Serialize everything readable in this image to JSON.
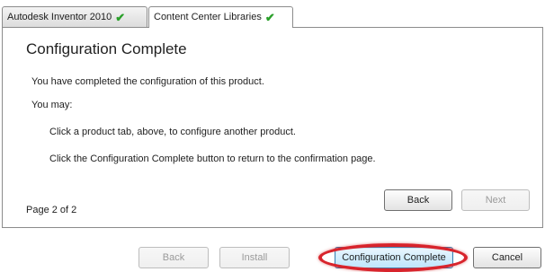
{
  "tabs": [
    {
      "label": "Autodesk Inventor 2010",
      "icon": "check-icon",
      "active": false
    },
    {
      "label": "Content Center Libraries",
      "icon": "check-icon",
      "active": true
    }
  ],
  "panel": {
    "title": "Configuration Complete",
    "intro": "You have completed the configuration of this product.",
    "you_may": "You may:",
    "option_1": "Click a product tab, above, to configure another product.",
    "option_2": "Click the Configuration Complete button to return to the confirmation page.",
    "page_indicator": "Page 2 of 2",
    "back_label": "Back",
    "next_label": "Next"
  },
  "footer": {
    "back_label": "Back",
    "install_label": "Install",
    "config_complete_label": "Configuration Complete",
    "cancel_label": "Cancel"
  },
  "colors": {
    "check": "#2aa02a",
    "highlight": "#d8242c"
  }
}
